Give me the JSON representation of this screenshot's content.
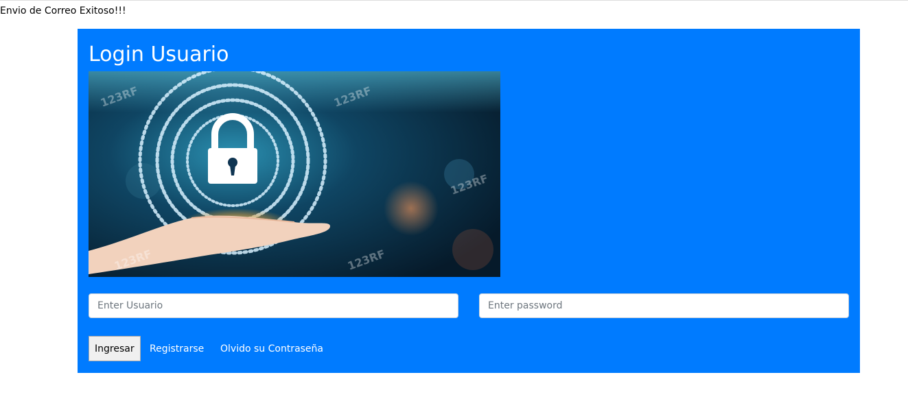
{
  "status_message": "Envio de Correo Exitoso!!!",
  "login": {
    "title": "Login Usuario",
    "username_placeholder": "Enter Usuario",
    "username_value": "",
    "password_placeholder": "Enter password",
    "password_value": "",
    "submit_label": "Ingresar",
    "register_link": "Registrarse",
    "forgot_link": "Olvido su Contraseña"
  },
  "hero_image": {
    "description_icons": [
      "padlock-icon",
      "open-hand",
      "binary-code-rings"
    ],
    "watermark": "123RF"
  },
  "colors": {
    "panel_background": "#007bff",
    "text_on_panel": "#ffffff",
    "page_background": "#ffffff"
  }
}
